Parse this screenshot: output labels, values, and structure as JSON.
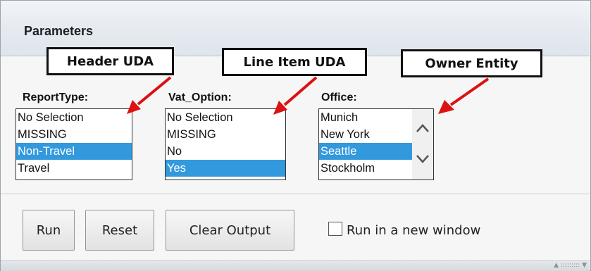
{
  "panel": {
    "title": "Parameters"
  },
  "callouts": [
    {
      "label": "Header UDA"
    },
    {
      "label": "Line Item UDA"
    },
    {
      "label": "Owner Entity"
    }
  ],
  "fields": [
    {
      "label": "ReportType:",
      "options": [
        "No Selection",
        "MISSING",
        "Non-Travel",
        "Travel"
      ],
      "selected": "Non-Travel"
    },
    {
      "label": "Vat_Option:",
      "options": [
        "No Selection",
        "MISSING",
        "No",
        "Yes"
      ],
      "selected": "Yes"
    },
    {
      "label": "Office:",
      "options": [
        "Munich",
        "New York",
        "Seattle",
        "Stockholm"
      ],
      "selected": "Seattle"
    }
  ],
  "buttons": {
    "run": "Run",
    "reset": "Reset",
    "clear_output": "Clear Output"
  },
  "new_window": {
    "label": "Run in a new window",
    "checked": false
  },
  "footer": {
    "grip": "▲ ::::::::: ▼"
  },
  "colors": {
    "selection": "#3399dd",
    "callout_arrow": "#dd1111"
  }
}
